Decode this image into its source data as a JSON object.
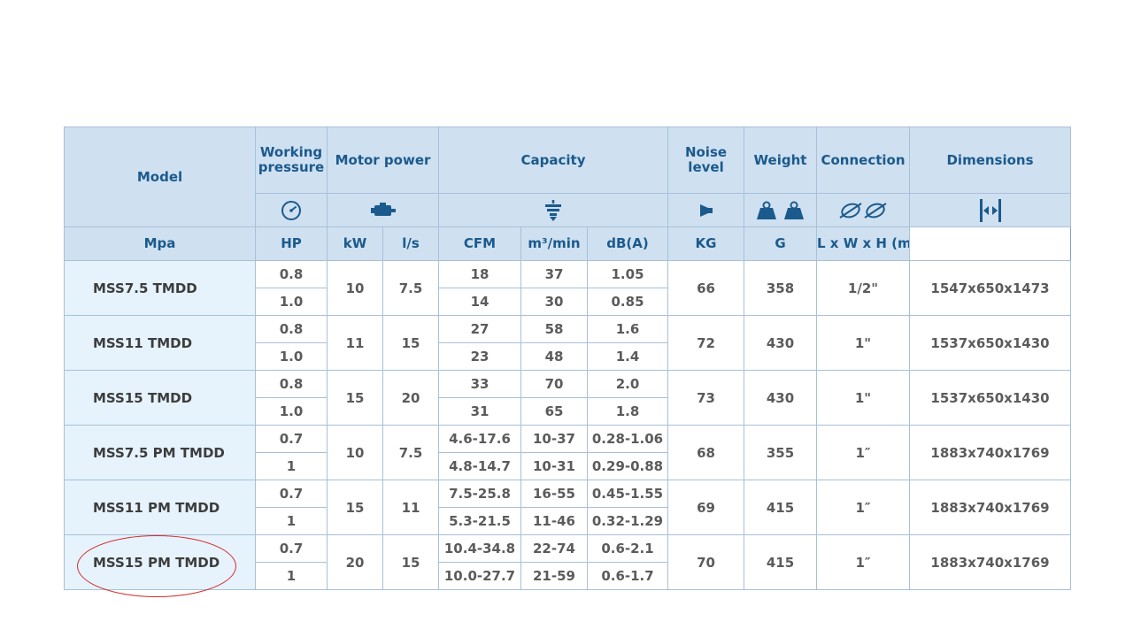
{
  "header": {
    "model": "Model",
    "working_pressure": "Working pressure",
    "motor_power": "Motor power",
    "capacity": "Capacity",
    "noise_level": "Noise level",
    "weight": "Weight",
    "connection": "Connection",
    "dimensions": "Dimensions"
  },
  "icons": {
    "pressure": "pressure-gauge-icon",
    "motor": "motor-icon",
    "capacity": "air-flow-icon",
    "noise": "speaker-icon",
    "weight": "weight-icon",
    "connection": "pipe-connection-icon",
    "dimensions": "dimensions-icon",
    "icon_color": "#1b5a8c"
  },
  "units": {
    "pressure": "Mpa",
    "hp": "HP",
    "kw": "kW",
    "ls": "l/s",
    "cfm": "CFM",
    "m3min": "m³/min",
    "db": "dB(A)",
    "kg": "KG",
    "g": "G",
    "dims": "L x W x H (mm)"
  },
  "models": [
    {
      "name": "MSS7.5 TMDD",
      "hp": "10",
      "kw": "7.5",
      "noise": "66",
      "weight": "358",
      "connection": "1/2\"",
      "dimensions": "1547x650x1473",
      "rows": [
        {
          "pressure": "0.8",
          "ls": "18",
          "cfm": "37",
          "m3min": "1.05"
        },
        {
          "pressure": "1.0",
          "ls": "14",
          "cfm": "30",
          "m3min": "0.85"
        }
      ]
    },
    {
      "name": "MSS11 TMDD",
      "hp": "11",
      "kw": "15",
      "noise": "72",
      "weight": "430",
      "connection": "1\"",
      "dimensions": "1537x650x1430",
      "rows": [
        {
          "pressure": "0.8",
          "ls": "27",
          "cfm": "58",
          "m3min": "1.6"
        },
        {
          "pressure": "1.0",
          "ls": "23",
          "cfm": "48",
          "m3min": "1.4"
        }
      ]
    },
    {
      "name": "MSS15 TMDD",
      "hp": "15",
      "kw": "20",
      "noise": "73",
      "weight": "430",
      "connection": "1\"",
      "dimensions": "1537x650x1430",
      "rows": [
        {
          "pressure": "0.8",
          "ls": "33",
          "cfm": "70",
          "m3min": "2.0"
        },
        {
          "pressure": "1.0",
          "ls": "31",
          "cfm": "65",
          "m3min": "1.8"
        }
      ]
    },
    {
      "name": "MSS7.5 PM TMDD",
      "hp": "10",
      "kw": "7.5",
      "noise": "68",
      "weight": "355",
      "connection": "1″",
      "dimensions": "1883x740x1769",
      "rows": [
        {
          "pressure": "0.7",
          "ls": "4.6-17.6",
          "cfm": "10-37",
          "m3min": "0.28-1.06"
        },
        {
          "pressure": "1",
          "ls": "4.8-14.7",
          "cfm": "10-31",
          "m3min": "0.29-0.88"
        }
      ]
    },
    {
      "name": "MSS11 PM TMDD",
      "hp": "15",
      "kw": "11",
      "noise": "69",
      "weight": "415",
      "connection": "1″",
      "dimensions": "1883x740x1769",
      "rows": [
        {
          "pressure": "0.7",
          "ls": "7.5-25.8",
          "cfm": "16-55",
          "m3min": "0.45-1.55"
        },
        {
          "pressure": "1",
          "ls": "5.3-21.5",
          "cfm": "11-46",
          "m3min": "0.32-1.29"
        }
      ]
    },
    {
      "name": "MSS15 PM TMDD",
      "hp": "20",
      "kw": "15",
      "noise": "70",
      "weight": "415",
      "connection": "1″",
      "dimensions": "1883x740x1769",
      "rows": [
        {
          "pressure": "0.7",
          "ls": "10.4-34.8",
          "cfm": "22-74",
          "m3min": "0.6-2.1"
        },
        {
          "pressure": "1",
          "ls": "10.0-27.7",
          "cfm": "21-59",
          "m3min": "0.6-1.7"
        }
      ]
    }
  ],
  "highlight": {
    "model_index": 5,
    "color": "#d42a2a"
  }
}
